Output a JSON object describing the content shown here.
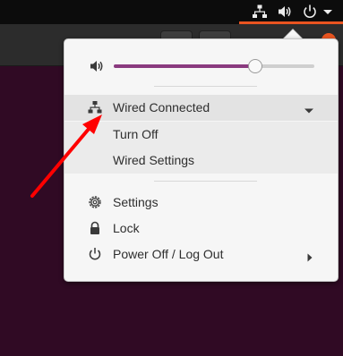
{
  "topbar": {
    "icons": [
      "network-wired-icon",
      "volume-icon",
      "power-icon",
      "chevron-down-icon"
    ]
  },
  "system_menu": {
    "volume": {
      "level": 0.7,
      "icon": "volume-icon"
    },
    "network": {
      "label": "Wired Connected",
      "icon": "network-wired-icon",
      "expanded": true,
      "items": [
        {
          "label": "Turn Off"
        },
        {
          "label": "Wired Settings"
        }
      ]
    },
    "items": [
      {
        "label": "Settings",
        "icon": "settings-icon"
      },
      {
        "label": "Lock",
        "icon": "lock-icon"
      },
      {
        "label": "Power Off / Log Out",
        "icon": "power-icon"
      }
    ]
  },
  "colors": {
    "accent": "#e95420",
    "slider_fill": "#8a3a7f",
    "desktop": "#300a24",
    "annotation_arrow": "#ff0000"
  }
}
